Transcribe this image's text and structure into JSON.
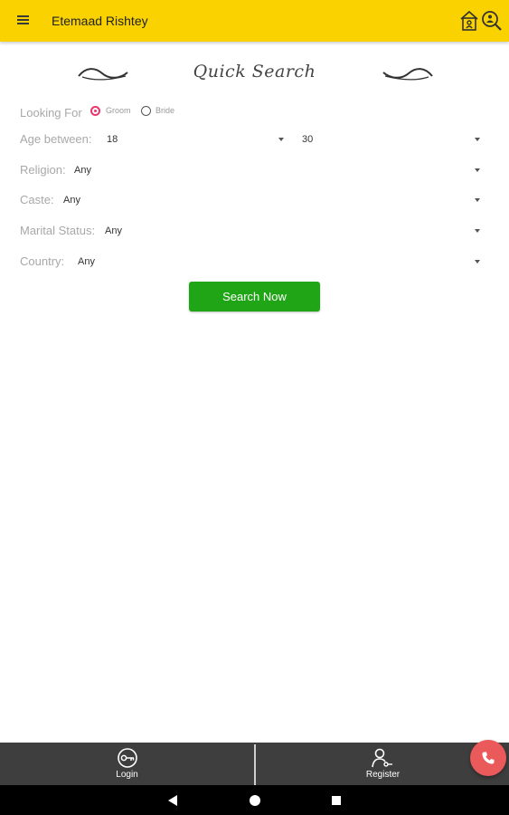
{
  "app_bar": {
    "title": "Etemaad Rishtey",
    "menu_icon": "hamburger-menu-icon",
    "actions": [
      "lock-profile-icon",
      "search-user-icon"
    ]
  },
  "quick_search": {
    "heading": "Quick Search",
    "looking_for": {
      "label": "Looking For",
      "options": [
        {
          "label": "Groom",
          "selected": true
        },
        {
          "label": "Bride",
          "selected": false
        }
      ]
    },
    "age": {
      "label": "Age between:",
      "from": "18",
      "to": "30"
    },
    "religion": {
      "label": "Religion:",
      "value": "Any"
    },
    "caste": {
      "label": "Caste:",
      "value": "Any"
    },
    "marital_status": {
      "label": "Marital Status:",
      "value": "Any"
    },
    "country": {
      "label": "Country:",
      "value": "Any"
    },
    "search_button": "Search Now"
  },
  "bottom_nav": {
    "login": {
      "label": "Login",
      "icon": "login-key-icon"
    },
    "register": {
      "label": "Register",
      "icon": "register-user-icon"
    }
  },
  "fab": {
    "icon": "phone-icon"
  },
  "system_nav": [
    "back-icon",
    "home-icon",
    "recents-icon"
  ],
  "colors": {
    "app_bar": "#f9d200",
    "accent_radio": "#e8356b",
    "search_button": "#1fa515",
    "bottom_bar": "#3e3e3e",
    "fab": "#ea5a5a"
  }
}
